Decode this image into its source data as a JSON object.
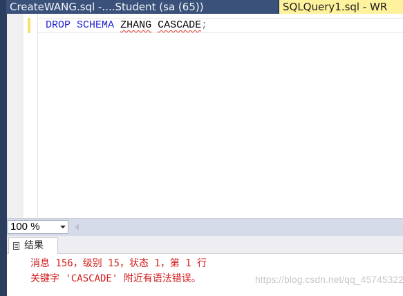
{
  "tabs": [
    {
      "label": "CreateWANG.sql -....Student (sa (65))",
      "active": false
    },
    {
      "label": "SQLQuery1.sql - WR",
      "active": true
    }
  ],
  "editor": {
    "tokens": {
      "kw1": "DROP",
      "kw2": "SCHEMA",
      "ident1": "ZHANG",
      "ident2": "CASCADE",
      "punct": ";"
    }
  },
  "statusbar": {
    "zoom": "100 %"
  },
  "results": {
    "tab_label": "结果",
    "message_line1": "消息 156，级别 15，状态 1，第 1 行",
    "message_line2": "关键字 'CASCADE' 附近有语法错误。",
    "watermark": "https://blog.csdn.net/qq_45745322"
  },
  "colors": {
    "keyword": "#1f1fd6",
    "error": "#d21d1d",
    "active_tab": "#fff29d",
    "tab_bar": "#2b3e5f"
  }
}
